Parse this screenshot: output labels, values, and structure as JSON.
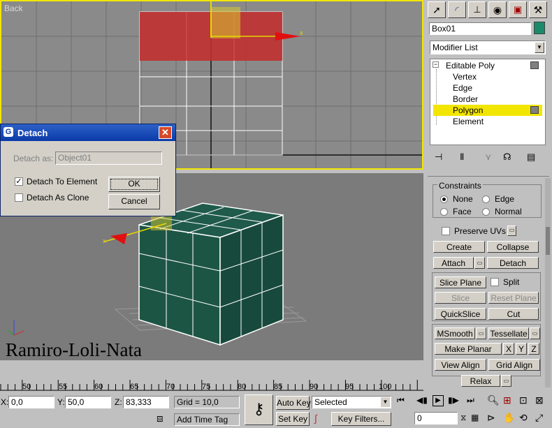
{
  "viewports": {
    "top_label": "Back"
  },
  "watermark": "Ramiro-Loli-Nata",
  "toolbar_tabs": [
    "create-icon",
    "modify-icon",
    "hierarchy-icon",
    "motion-icon",
    "display-icon",
    "utilities-icon"
  ],
  "object": {
    "name": "Box01",
    "color": "#1a8a6a",
    "modifier_list": "Modifier List"
  },
  "stack": {
    "root": "Editable Poly",
    "items": [
      "Vertex",
      "Edge",
      "Border",
      "Polygon",
      "Element"
    ],
    "selected": "Polygon"
  },
  "constraints": {
    "title": "Constraints",
    "options": [
      "None",
      "Edge",
      "Face",
      "Normal"
    ],
    "selected": "None"
  },
  "edit_buttons": {
    "preserve_uvs": "Preserve UVs",
    "create": "Create",
    "collapse": "Collapse",
    "attach": "Attach",
    "detach": "Detach",
    "slice_plane": "Slice Plane",
    "split": "Split",
    "slice": "Slice",
    "reset_plane": "Reset Plane",
    "quickslice": "QuickSlice",
    "cut": "Cut",
    "msmooth": "MSmooth",
    "tessellate": "Tessellate",
    "make_planar": "Make Planar",
    "x": "X",
    "y": "Y",
    "z": "Z",
    "view_align": "View Align",
    "grid_align": "Grid Align",
    "relax": "Relax"
  },
  "dialog": {
    "title": "Detach",
    "detach_as_label": "Detach as:",
    "detach_as_value": "Object01",
    "to_element": "Detach To Element",
    "to_element_checked": true,
    "as_clone": "Detach As Clone",
    "as_clone_checked": false,
    "ok": "OK",
    "cancel": "Cancel"
  },
  "timeline": {
    "ticks": [
      "50",
      "55",
      "60",
      "65",
      "70",
      "75",
      "80",
      "85",
      "90",
      "95",
      "100"
    ]
  },
  "status": {
    "x_label": "X:",
    "x_value": "0,0",
    "y_label": "Y:",
    "y_value": "50,0",
    "z_label": "Z:",
    "z_value": "83,333",
    "grid": "Grid = 10,0",
    "auto_key": "Auto Key",
    "set_key": "Set Key",
    "selected_dropdown": "Selected",
    "key_filters": "Key Filters...",
    "add_time_tag": "Add Time Tag",
    "frame": "0"
  }
}
